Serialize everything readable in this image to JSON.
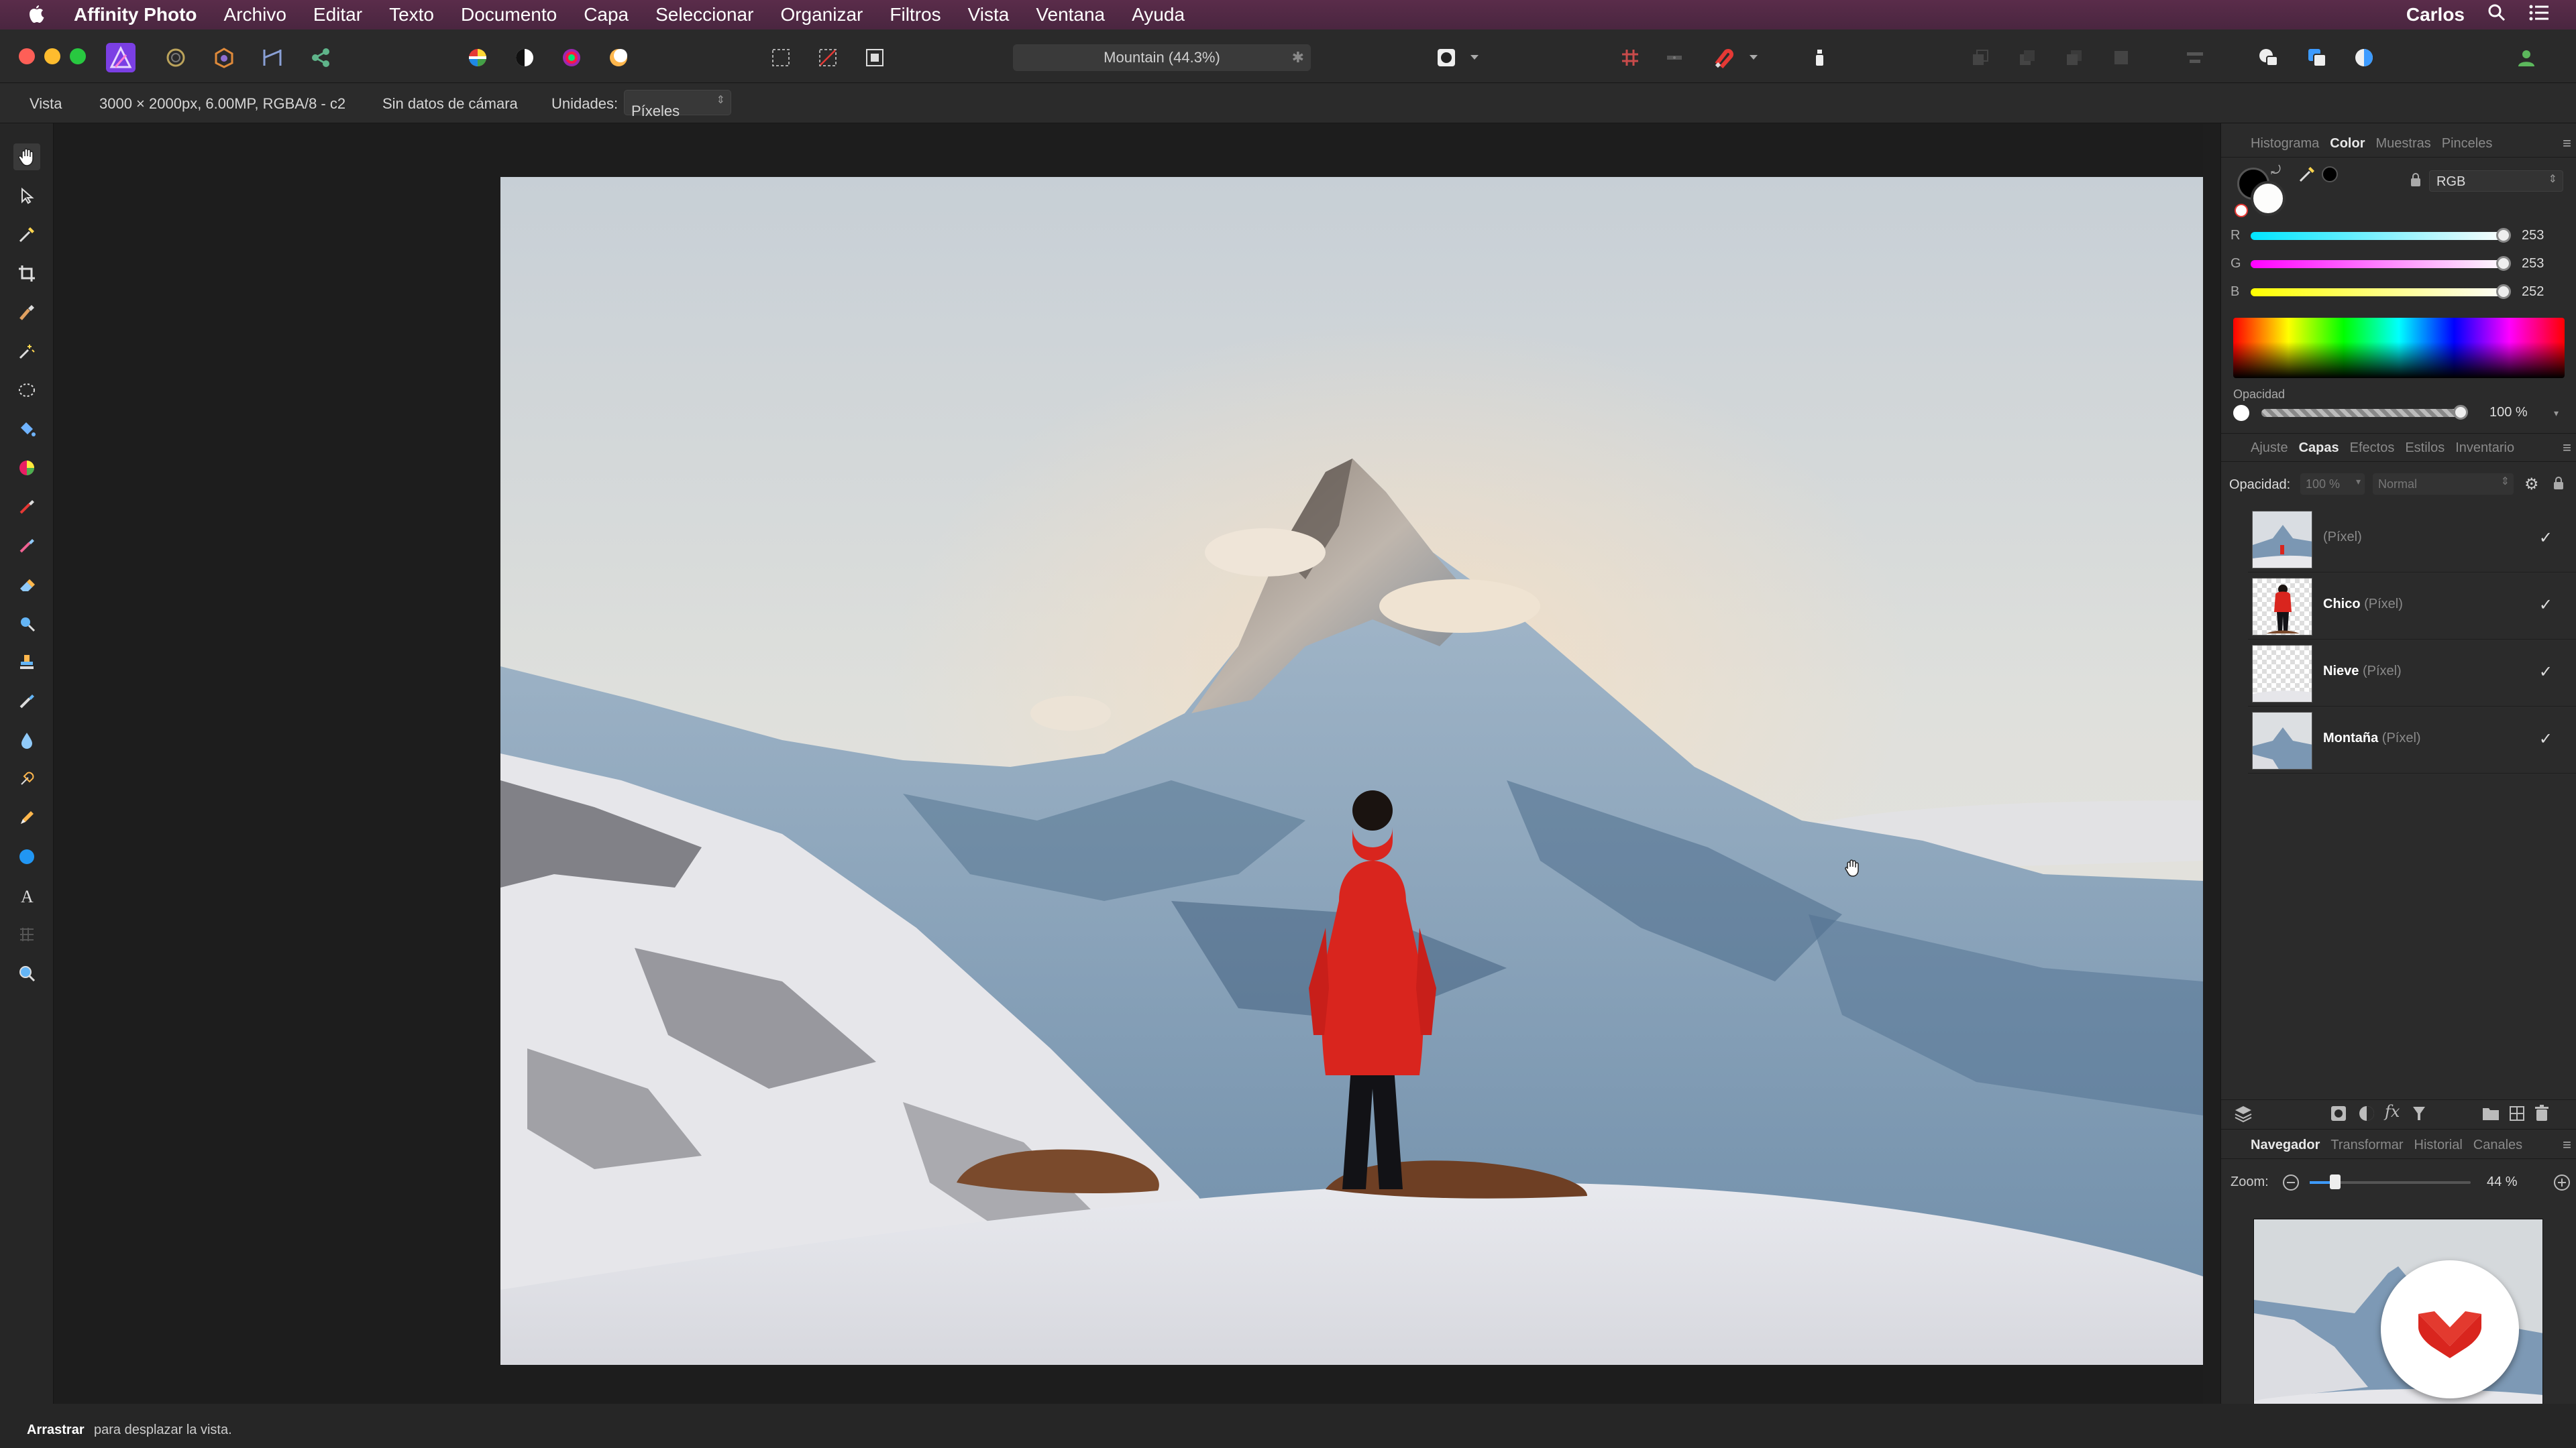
{
  "menubar": {
    "app_name": "Affinity Photo",
    "items": [
      "Archivo",
      "Editar",
      "Texto",
      "Documento",
      "Capa",
      "Seleccionar",
      "Organizar",
      "Filtros",
      "Vista",
      "Ventana",
      "Ayuda"
    ],
    "user": "Carlos"
  },
  "toolbar": {
    "document_title": "Mountain (44.3%)"
  },
  "context": {
    "vista_label": "Vista",
    "doc_info": "3000 × 2000px, 6.00MP, RGBA/8 - c2",
    "camera_info": "Sin datos de cámara",
    "units_label": "Unidades:",
    "units_value": "Píxeles"
  },
  "color_panel": {
    "tabs": [
      "Histograma",
      "Color",
      "Muestras",
      "Pinceles"
    ],
    "active_tab": "Color",
    "mode": "RGB",
    "r_label": "R",
    "g_label": "G",
    "b_label": "B",
    "r": 253,
    "g": 253,
    "b": 252,
    "opacity_label": "Opacidad",
    "opacity_value": "100 %"
  },
  "layers_panel": {
    "tabs": [
      "Ajuste",
      "Capas",
      "Efectos",
      "Estilos",
      "Inventario"
    ],
    "active_tab": "Capas",
    "opacity_label": "Opacidad:",
    "opacity_value": "100 %",
    "blend_mode": "Normal",
    "layers": [
      {
        "name": "",
        "type": "(Píxel)",
        "visible": true
      },
      {
        "name": "Chico",
        "type": "(Píxel)",
        "visible": true
      },
      {
        "name": "Nieve",
        "type": "(Píxel)",
        "visible": true
      },
      {
        "name": "Montaña",
        "type": "(Píxel)",
        "visible": true
      }
    ]
  },
  "navigator_panel": {
    "tabs": [
      "Navegador",
      "Transformar",
      "Historial",
      "Canales"
    ],
    "active_tab": "Navegador",
    "zoom_label": "Zoom:",
    "zoom_value": "44 %"
  },
  "status": {
    "bold": "Arrastrar",
    "text": "para desplazar la vista."
  },
  "colors": {
    "menubar": "#4f2944",
    "accent_red": "#d9251e",
    "slider_r": "#00e5ff",
    "slider_g": "#ff00ff",
    "slider_b": "#ffff00"
  }
}
